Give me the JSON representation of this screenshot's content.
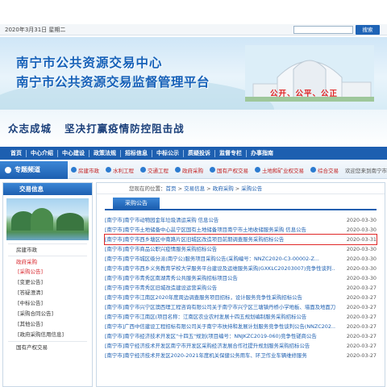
{
  "topbar": {
    "date": "2020年3月31日 星期二",
    "search_button": "搜索",
    "search_placeholder": ""
  },
  "banner": {
    "title1": "南宁市公共资源交易中心",
    "title2": "南宁市公共资源交易监督管理平台",
    "motto": "公开、公平、公正"
  },
  "slogan": {
    "part1": "众志成城",
    "part2": "坚决打赢疫情防控阻击战"
  },
  "nav": [
    "首页",
    "中心介绍",
    "中心建设",
    "政策法规",
    "招标信息",
    "中标公示",
    "质疑投诉",
    "监督专栏",
    "办事指南"
  ],
  "channel": {
    "title": "专题频道",
    "items": [
      "房建市政",
      "水利工程",
      "交通工程",
      "政府采购",
      "国有产权交易",
      "土地和矿业权交易",
      "综合交易"
    ],
    "welcome": "欢迎您来到南宁市"
  },
  "sidebar": {
    "title": "交易信息",
    "items": [
      {
        "label": "房建市政",
        "active": false
      },
      {
        "label": "政府采购",
        "active": true
      }
    ],
    "subitems": [
      {
        "label": "[采购公告]",
        "active": true
      },
      {
        "label": "[变更公告]",
        "active": false
      },
      {
        "label": "[答疑澄清]",
        "active": false
      },
      {
        "label": "[中标公告]",
        "active": false
      },
      {
        "label": "[采购合同公告]",
        "active": false
      },
      {
        "label": "[其他公告]",
        "active": false
      },
      {
        "label": "[政府采购信用信息]",
        "active": false
      }
    ],
    "bottom_item": "国有产权交易"
  },
  "main": {
    "breadcrumb": {
      "prefix": "您现在的位置：",
      "home": "首页",
      "sep": " > ",
      "p1": "交易信息",
      "p2": "政府采购",
      "p3": "采购公告"
    },
    "tab": "采购公告",
    "rows": [
      {
        "title": "[南宁市]南宁市动物园金年垃圾清运采购 信息公告",
        "date": "2020-03-30",
        "highlight": false
      },
      {
        "title": "[南宁市]南宁市土地储备中心邕宁区国有土地储备项目南宁市土地收储服务采购 信息公告",
        "date": "2020-03-30",
        "highlight": false
      },
      {
        "title": "[南宁市]南宁市西乡塘区中南路片区旧城区改造项目前期调查服务采购招标公告",
        "date": "2020-03-31",
        "highlight": true
      },
      {
        "title": "[南宁市]南宁市商品公职兴疫情服务采购招标公告",
        "date": "2020-03-30",
        "highlight": false
      },
      {
        "title": "[南宁市]南宁市城区级分派(南宁公)服务项目采购公告(采购编号：NNZC2020-C3-00002-Z...",
        "date": "2020-03-30",
        "highlight": false
      },
      {
        "title": "[南宁市]南宁市西乡义务教育学校大学服务平台建设及运维服务采购(GXKLC20203007)竞争性谈判...",
        "date": "2020-03-30",
        "highlight": false
      },
      {
        "title": "[南宁市]南宁市青秀区南湖青秀公共服务采购招标项目公告",
        "date": "2020-03-30",
        "highlight": false
      },
      {
        "title": "[南宁市]南宁市青秀区旧城改造建设运营采购公告",
        "date": "2020-03-27",
        "highlight": false
      },
      {
        "title": "[南宁市]南宁市江南区2020年度周边调查服务项目招标，设计服务竞争性采购招标公告",
        "date": "2020-03-27",
        "highlight": false
      },
      {
        "title": "[南宁市]南宁市兴宁区澳西理工程咨询有限公司关于南宁市兴宁区三塘镇丹桥小学地板、墙面及地面刀..",
        "date": "2020-03-27",
        "highlight": false
      },
      {
        "title": "[南宁市]南宁市江南区(项目名称：江南区农业农村发展十四五规划编制服务采购招标公告",
        "date": "2020-03-27",
        "highlight": false
      },
      {
        "title": "[南宁市]广西中信建设工程招标有限公司关于南宁市扶持和发展计划服务竞争性谈判公告(NNZC202...",
        "date": "2020-03-27",
        "highlight": false
      },
      {
        "title": "[南宁市]南宁市经济技术开发区\"十四五\"规划(项目编号：NNJKZC2019-060)竞争性磋商公告",
        "date": "2020-03-27",
        "highlight": false
      },
      {
        "title": "[南宁市]南宁经济技术开发区南宁市开发区采购经济发展合作社提升规划服务采购招标公告",
        "date": "2020-03-27",
        "highlight": false
      },
      {
        "title": "[南宁市]南宁经济技术开发区2020-2021年度机关保健公务用车、环卫作业车辆维修服务",
        "date": "2020-03-27",
        "highlight": false
      }
    ]
  },
  "colors": {
    "nav_bg": "#1d5fb0",
    "link": "#1d5fb0",
    "highlight_border": "#e02828",
    "motto": "#e02020"
  }
}
